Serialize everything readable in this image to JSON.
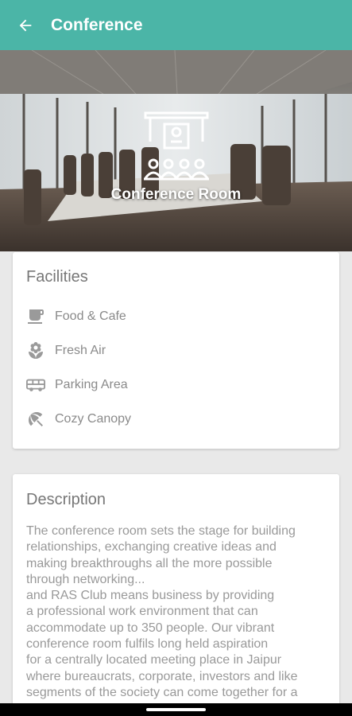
{
  "appbar": {
    "title": "Conference",
    "back_icon": "arrow-back-icon",
    "color": "#4bb5a7"
  },
  "hero": {
    "caption": "Conference Room",
    "emblem_icon": "conference-room-icon"
  },
  "facilities": {
    "title": "Facilities",
    "items": [
      {
        "label": "Food & Cafe",
        "icon": "coffee-cup-icon"
      },
      {
        "label": "Fresh Air",
        "icon": "flower-icon"
      },
      {
        "label": "Parking Area",
        "icon": "bus-icon"
      },
      {
        "label": "Cozy Canopy",
        "icon": "umbrella-beach-icon"
      }
    ]
  },
  "description": {
    "title": "Description",
    "text": "The conference room sets the stage for building\nrelationships, exchanging creative ideas and\nmaking breakthroughs all the more possible\nthrough networking...\nand RAS Club means business by providing\na professional work environment that can\naccommodate up to 350 people. Our vibrant\nconference room fulfils long held aspiration\nfor a centrally located meeting place in Jaipur\nwhere bureaucrats, corporate, investors and like\nsegments of the society can come together for a"
  }
}
